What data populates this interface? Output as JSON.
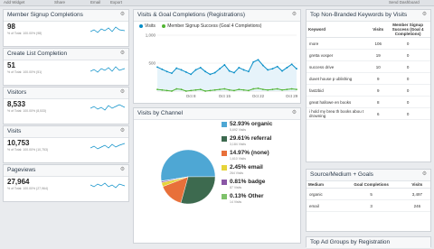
{
  "topbar": {
    "items": [
      "Add Widget",
      "Share",
      "Email",
      "Export",
      "Send Dashboard"
    ]
  },
  "metrics": [
    {
      "title": "Member Signup Completions",
      "value": "98",
      "sub": "% of Total: 100.00% (98)"
    },
    {
      "title": "Create List Completion",
      "value": "51",
      "sub": "% of Total: 100.00% (51)"
    },
    {
      "title": "Visitors",
      "value": "8,533",
      "sub": "% of Total: 100.00% (8,533)"
    },
    {
      "title": "Visits",
      "value": "10,753",
      "sub": "% of Total: 100.00% (10,753)"
    },
    {
      "title": "Pageviews",
      "value": "27,964",
      "sub": "% of Total: 100.00% (27,964)"
    }
  ],
  "line_panel": {
    "title": "Visits & Goal Completions (Registrations)",
    "legend": [
      "Visits",
      "Member Signup Success (Goal 4 Completions)"
    ],
    "colors": {
      "visits": "#058dc7",
      "goal": "#50b432"
    }
  },
  "pie_panel": {
    "title": "Visits by Channel"
  },
  "keywords_panel": {
    "title": "Top Non-Branded Keywords by Visits",
    "headers": [
      "Keyword",
      "Visits",
      "Member Signup Success (Goal 4 Completions)"
    ],
    "rows": [
      [
        "more",
        "106",
        "0"
      ],
      [
        "gretta vosper",
        "19",
        "0"
      ],
      [
        "success drive",
        "10",
        "0"
      ],
      [
        "duvet house p ublishing",
        "9",
        "0"
      ],
      [
        "fast2bid",
        "9",
        "0"
      ],
      [
        "great hallowe en books",
        "8",
        "0"
      ],
      [
        "i hold my brea th books abou t drowning",
        "6",
        "0"
      ]
    ]
  },
  "source_panel": {
    "title": "Source/Medium + Goals",
    "headers": [
      "Medium",
      "Goal Completions",
      "Visits"
    ],
    "rows": [
      [
        "organic",
        "5",
        "3,497"
      ],
      [
        "email",
        "3",
        "246"
      ]
    ]
  },
  "bottom_panel": {
    "title": "Top Ad Groups by Registration"
  },
  "chart_data": [
    {
      "type": "line",
      "title": "Visits & Goal Completions (Registrations)",
      "categories": [
        "Oct 1",
        "Oct 2",
        "Oct 3",
        "Oct 4",
        "Oct 5",
        "Oct 6",
        "Oct 7",
        "Oct 8",
        "Oct 9",
        "Oct 10",
        "Oct 11",
        "Oct 12",
        "Oct 13",
        "Oct 14",
        "Oct 15",
        "Oct 16",
        "Oct 17",
        "Oct 18",
        "Oct 19",
        "Oct 20",
        "Oct 21",
        "Oct 22",
        "Oct 23",
        "Oct 24",
        "Oct 25",
        "Oct 26",
        "Oct 27",
        "Oct 28",
        "Oct 29",
        "Oct 30"
      ],
      "xticks": [
        "Oct 8",
        "Oct 15",
        "Oct 22",
        "Oct 29"
      ],
      "yticks": [
        "1,000",
        "500"
      ],
      "ylim": [
        0,
        1000
      ],
      "series": [
        {
          "name": "Visits",
          "values": [
            430,
            390,
            350,
            320,
            410,
            380,
            340,
            300,
            380,
            420,
            350,
            300,
            330,
            400,
            470,
            360,
            330,
            420,
            380,
            350,
            520,
            560,
            460,
            380,
            400,
            440,
            360,
            420,
            480,
            400
          ]
        },
        {
          "name": "Member Signup Success (Goal 4 Completions)",
          "values": [
            30,
            20,
            10,
            0,
            40,
            30,
            0,
            10,
            20,
            30,
            0,
            10,
            20,
            30,
            40,
            20,
            10,
            30,
            20,
            10,
            40,
            50,
            30,
            20,
            30,
            40,
            20,
            30,
            40,
            30
          ]
        }
      ]
    },
    {
      "type": "pie",
      "title": "Visits by Channel",
      "series": [
        {
          "name": "organic",
          "value": 52.93,
          "label": "52.93% organic",
          "sub": "5,692 Visits",
          "color": "#4ea7d4"
        },
        {
          "name": "referral",
          "value": 29.61,
          "label": "29.61% referral",
          "sub": "3,184 Visits",
          "color": "#3d6a4f"
        },
        {
          "name": "(none)",
          "value": 14.97,
          "label": "14.97% (none)",
          "sub": "1,610 Visits",
          "color": "#e8703a"
        },
        {
          "name": "email",
          "value": 2.45,
          "label": "2.45% email",
          "sub": "264 Visits",
          "color": "#e6d43a"
        },
        {
          "name": "badge",
          "value": 0.81,
          "label": "0.81% badge",
          "sub": "87 Visits",
          "color": "#8a57a6"
        },
        {
          "name": "Other",
          "value": 0.13,
          "label": "0.13% Other",
          "sub": "14 Visits",
          "color": "#7fc26b"
        }
      ]
    }
  ]
}
